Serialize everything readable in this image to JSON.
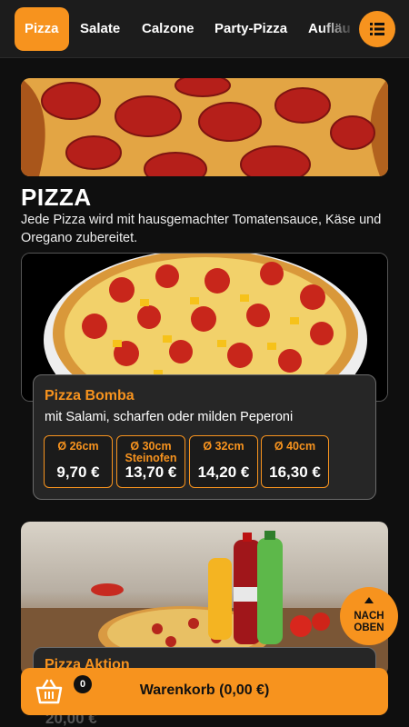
{
  "nav": {
    "tabs": [
      {
        "label": "Pizza",
        "active": true
      },
      {
        "label": "Salate",
        "active": false
      },
      {
        "label": "Calzone",
        "active": false
      },
      {
        "label": "Party-Pizza",
        "active": false
      },
      {
        "label": "Aufläu",
        "active": false
      }
    ],
    "menu_icon": "list-icon"
  },
  "section": {
    "title": "PIZZA",
    "description": "Jede Pizza wird mit hausgemachter Tomatensauce, Käse und Oregano zubereitet."
  },
  "product": {
    "name": "Pizza Bomba",
    "description": "mit Salami, scharfen oder milden Peperoni",
    "prices": [
      {
        "size": "Ø 26cm",
        "price": "9,70 €"
      },
      {
        "size": "Ø 30cm Steinofen",
        "price": "13,70 €"
      },
      {
        "size": "Ø 32cm",
        "price": "14,20 €"
      },
      {
        "size": "Ø 40cm",
        "price": "16,30 €"
      }
    ]
  },
  "promo": {
    "title": "Pizza Aktion",
    "partial_price": "20,00 €"
  },
  "cart": {
    "label": "Warenkorb (0,00 €)",
    "count": "0",
    "icon": "basket-icon"
  },
  "scroll_top": {
    "label": "NACH OBEN",
    "icon": "arrow-up-icon"
  },
  "colors": {
    "accent": "#f7931e",
    "background": "#0f0f0f",
    "card": "#262626"
  }
}
